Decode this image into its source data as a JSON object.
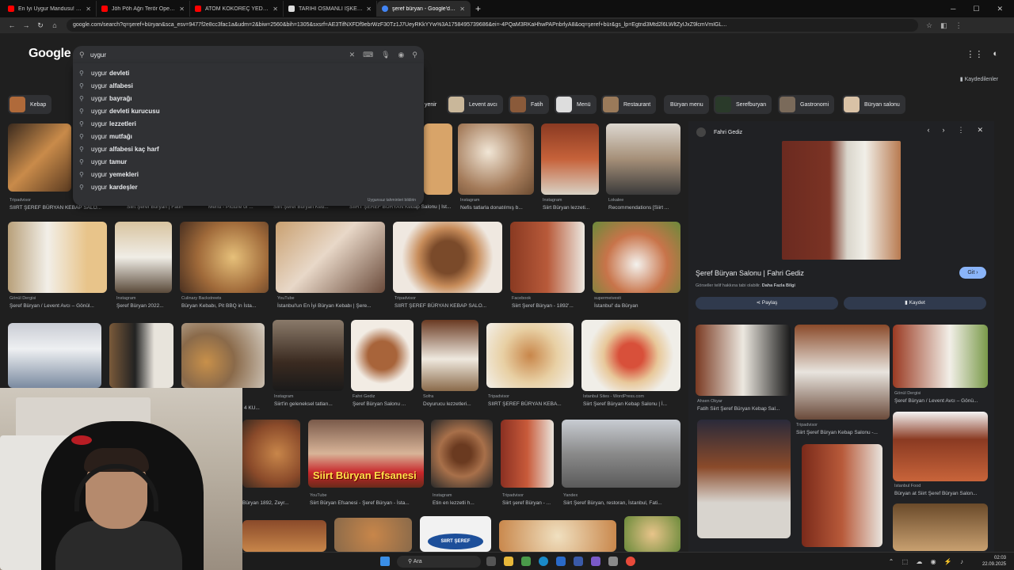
{
  "browser": {
    "tabs": [
      {
        "title": "En İyi Uygur Mandusu! UYGUR",
        "color": "#ff0000"
      },
      {
        "title": "Jöh Pöh Ağrı Terör Operasyon",
        "color": "#ff0000"
      },
      {
        "title": "ATOM KOKOREÇ YEDİNİZ Mİ?",
        "color": "#ff0000"
      },
      {
        "title": "TARİHİ OSMANLI İŞKEMBE KEL",
        "color": "#ffffff"
      },
      {
        "title": "şeref büryan - Google'da Ara",
        "color": "#4285f4"
      }
    ],
    "url": "google.com/search?q=şeref+büryan&sca_esv=9477f2e8cc3fac1a&udm=2&biw=2560&bih=1305&sxsrf=AE3TifNXFDf9ebrWzF30Tz1J7UeyRKkYYw%3A1758495739686&ei=-4PQaM3RKaHhwPAPnbrlyA8&oq=şeref+bür&gs_lp=Egtnd3Mtd2l6LWltZyIJxZ9lcmVmIGL..."
  },
  "google": {
    "logo": "Google",
    "query": "uygur",
    "saved_label": "Kaydedilenler",
    "suggest_prefix": "uygur",
    "suggestions": [
      "devleti",
      "alfabesi",
      "bayrağı",
      "devleti kurucusu",
      "lezzetleri",
      "mutfağı",
      "alfabesi kaç harf",
      "tamur",
      "yemekleri",
      "kardeşler"
    ],
    "suggest_note": "Uygunsuz tahminleri bildirin"
  },
  "chips": [
    "Kebap",
    "Levent avcı",
    "Fatih",
    "Menü",
    "Restaurant",
    "Büryan menu",
    "Serefburyan",
    "Gastronomi",
    "Büryan salonu"
  ],
  "chip_partial": "yenir",
  "results": [
    {
      "src": "Tripadvisor",
      "title": "SIIRT ŞEREF BÜRYAN KEBAP SALO..."
    },
    {
      "src": "",
      "title": "Siirt Şeref Büryan | Fatih"
    },
    {
      "src": "",
      "title": "Menu - Picture of ..."
    },
    {
      "src": "",
      "title": "Siirt Şeref Büryan Keb..."
    },
    {
      "src": "",
      "title": "SIIRT ŞEREF BÜRYAN Kebap Salonu | İst..."
    },
    {
      "src": "Instagram",
      "title": "Nefis tatlarla donatılmış b..."
    },
    {
      "src": "Instagram",
      "title": "Siirt Büryan lezzeti..."
    },
    {
      "src": "Lokalee",
      "title": "Recommendations [Siirt ..."
    },
    {
      "src": "Gönül Dergisi",
      "title": "Şeref Büryan / Levent Avcı – Gönül..."
    },
    {
      "src": "Instagram",
      "title": "Şeref Büryan 2022..."
    },
    {
      "src": "Culinary Backstreets",
      "title": "Büryan Kebabı, Pit BBQ in İsta..."
    },
    {
      "src": "YouTube",
      "title": "İstanbul'un En İyi Büryan Kebabı | Şere..."
    },
    {
      "src": "Tripadvisor",
      "title": "SIIRT ŞEREF BÜRYAN KEBAP SALO..."
    },
    {
      "src": "Facebook",
      "title": "Siirt Şeref Büryan - 1892'..."
    },
    {
      "src": "supermeivesti",
      "title": "İstanbul' da Büryan"
    },
    {
      "src": "",
      "title": "4 KU..."
    },
    {
      "src": "Instagram",
      "title": "Siirt'in geleneksel tatları..."
    },
    {
      "src": "Fahri Gediz",
      "title": "Şeref Büryan Salonu ..."
    },
    {
      "src": "Sofra",
      "title": "Doyurucu lezzetleri..."
    },
    {
      "src": "Tripadvisor",
      "title": "SIIRT ŞEREF BÜRYAN KEBA..."
    },
    {
      "src": "İstanbul Sites - WordPress.com",
      "title": "Siirt Şeref Büryan Kebap Salonu | İ..."
    },
    {
      "src": "",
      "title": "Büryan 1892, Zeyr..."
    },
    {
      "src": "YouTube",
      "title": "Siirt Büryan Efsanesi - Şeref Büryan - İsta..."
    },
    {
      "src": "Instagram",
      "title": "Etin en lezzetli h..."
    },
    {
      "src": "Tripadvisor",
      "title": "Siirt şeref Büryan - ..."
    },
    {
      "src": "Yandex",
      "title": "Siirt Şeref Büryan, restoran, İstanbul, Fati..."
    }
  ],
  "thumb_text": {
    "siirt_efsanesi": "Siirt Büryan Efsanesi",
    "siirt_logo": "SIIRT ŞEREF"
  },
  "panel": {
    "source": "Fahri Gediz",
    "title": "Şeref Büryan Salonu | Fahri Gediz",
    "go": "Git",
    "note_prefix": "Görseller telif hakkına tabi olabilir.",
    "note_link": "Daha Fazla Bilgi",
    "share": "Paylaş",
    "save": "Kaydet",
    "related": [
      {
        "src": "Ahsen Okyar",
        "title": "Fatih Siirt Şeref Büryan Kebap Sal..."
      },
      {
        "src": "Tripadvisor",
        "title": "Siirt Şeref Büryan Kebap Salonu -..."
      },
      {
        "src": "Gönül Dergisi",
        "title": "Şeref Büryan / Levent Avcı – Gönü..."
      },
      {
        "src": "İstanbul Food",
        "title": "Büryan at Siirt Şeref Büryan Salon..."
      }
    ]
  },
  "taskbar": {
    "search": "Ara",
    "time": "02:03",
    "date": "22.09.2025"
  }
}
